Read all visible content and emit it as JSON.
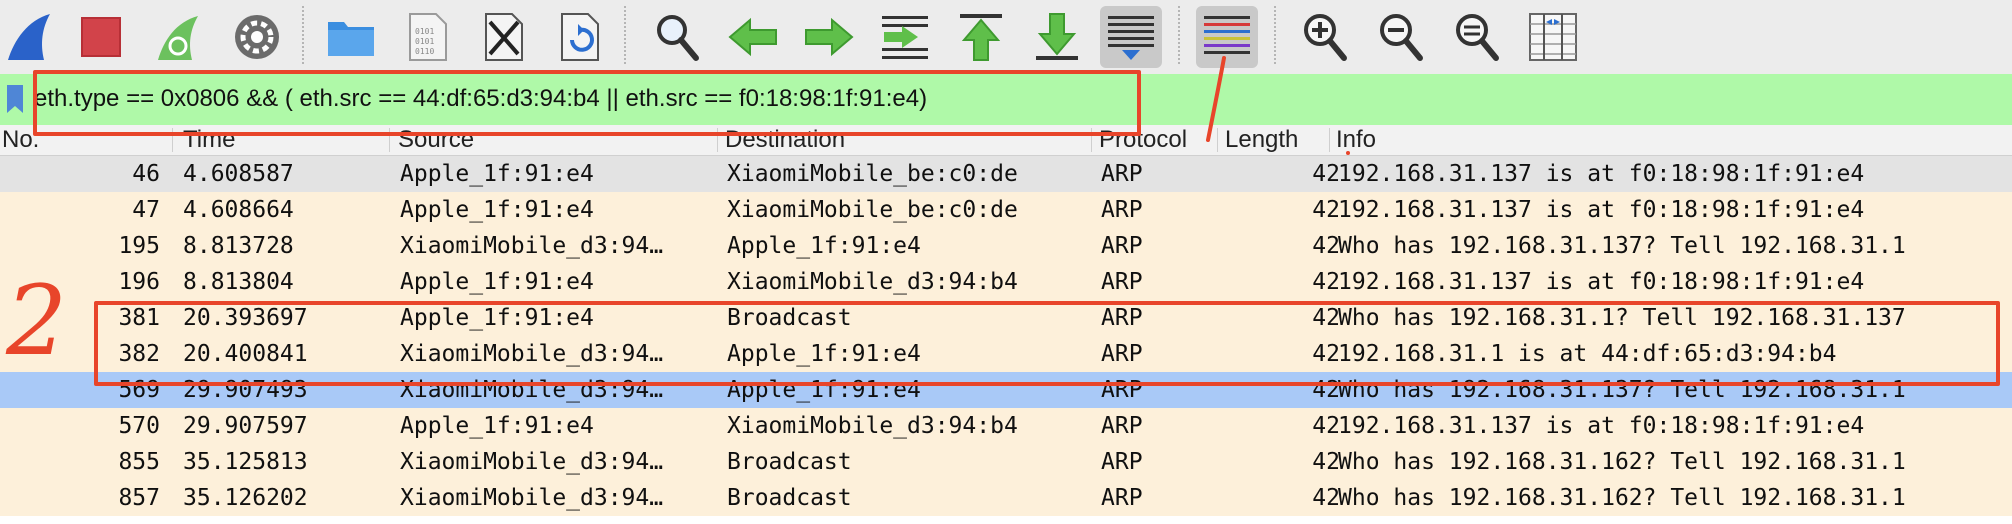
{
  "toolbar": {
    "buttons": [
      {
        "icon": "shark-fin-icon"
      },
      {
        "icon": "stop-capture-icon"
      },
      {
        "icon": "restart-capture-icon"
      },
      {
        "icon": "capture-options-icon"
      },
      {
        "icon": "open-file-icon"
      },
      {
        "icon": "save-file-icon"
      },
      {
        "icon": "close-file-icon"
      },
      {
        "icon": "reload-file-icon"
      },
      {
        "icon": "find-packet-icon"
      },
      {
        "icon": "go-back-icon"
      },
      {
        "icon": "go-forward-icon"
      },
      {
        "icon": "go-to-packet-icon"
      },
      {
        "icon": "go-to-first-packet-icon"
      },
      {
        "icon": "go-to-last-packet-icon"
      },
      {
        "icon": "auto-scroll-icon"
      },
      {
        "icon": "colorize-icon"
      },
      {
        "icon": "zoom-in-icon"
      },
      {
        "icon": "zoom-out-icon"
      },
      {
        "icon": "normal-size-icon"
      },
      {
        "icon": "resize-columns-icon"
      }
    ]
  },
  "filter": {
    "value": "eth.type == 0x0806 && ( eth.src == 44:df:65:d3:94:b4 || eth.src == f0:18:98:1f:91:e4)"
  },
  "columns": {
    "no": "No.",
    "time": "Time",
    "source": "Source",
    "destination": "Destination",
    "protocol": "Protocol",
    "length": "Length",
    "info": "Info"
  },
  "packets": [
    {
      "no": "46",
      "time": "4.608587",
      "source": "Apple_1f:91:e4",
      "destination": "XiaomiMobile_be:c0:de",
      "protocol": "ARP",
      "length": "42",
      "info": "192.168.31.137 is at f0:18:98:1f:91:e4"
    },
    {
      "no": "47",
      "time": "4.608664",
      "source": "Apple_1f:91:e4",
      "destination": "XiaomiMobile_be:c0:de",
      "protocol": "ARP",
      "length": "42",
      "info": "192.168.31.137 is at f0:18:98:1f:91:e4"
    },
    {
      "no": "195",
      "time": "8.813728",
      "source": "XiaomiMobile_d3:94…",
      "destination": "Apple_1f:91:e4",
      "protocol": "ARP",
      "length": "42",
      "info": "Who has 192.168.31.137? Tell 192.168.31.1"
    },
    {
      "no": "196",
      "time": "8.813804",
      "source": "Apple_1f:91:e4",
      "destination": "XiaomiMobile_d3:94:b4",
      "protocol": "ARP",
      "length": "42",
      "info": "192.168.31.137 is at f0:18:98:1f:91:e4"
    },
    {
      "no": "381",
      "time": "20.393697",
      "source": "Apple_1f:91:e4",
      "destination": "Broadcast",
      "protocol": "ARP",
      "length": "42",
      "info": "Who has 192.168.31.1? Tell 192.168.31.137"
    },
    {
      "no": "382",
      "time": "20.400841",
      "source": "XiaomiMobile_d3:94…",
      "destination": "Apple_1f:91:e4",
      "protocol": "ARP",
      "length": "42",
      "info": "192.168.31.1 is at 44:df:65:d3:94:b4"
    },
    {
      "no": "569",
      "time": "29.907493",
      "source": "XiaomiMobile_d3:94…",
      "destination": "Apple_1f:91:e4",
      "protocol": "ARP",
      "length": "42",
      "info": "Who has 192.168.31.137? Tell 192.168.31.1"
    },
    {
      "no": "570",
      "time": "29.907597",
      "source": "Apple_1f:91:e4",
      "destination": "XiaomiMobile_d3:94:b4",
      "protocol": "ARP",
      "length": "42",
      "info": "192.168.31.137 is at f0:18:98:1f:91:e4"
    },
    {
      "no": "855",
      "time": "35.125813",
      "source": "XiaomiMobile_d3:94…",
      "destination": "Broadcast",
      "protocol": "ARP",
      "length": "42",
      "info": "Who has 192.168.31.162? Tell 192.168.31.1"
    },
    {
      "no": "857",
      "time": "35.126202",
      "source": "XiaomiMobile_d3:94…",
      "destination": "Broadcast",
      "protocol": "ARP",
      "length": "42",
      "info": "Who has 192.168.31.162? Tell 192.168.31.1"
    }
  ],
  "selected_packet": "569",
  "annotations": {
    "label": "2"
  },
  "colors": {
    "row_cream": "#fdf0da",
    "row_gray": "#e3e3e3",
    "selected": "#a9c9f7",
    "filter_bg": "#aff9a8",
    "annotation": "#e8452a"
  }
}
